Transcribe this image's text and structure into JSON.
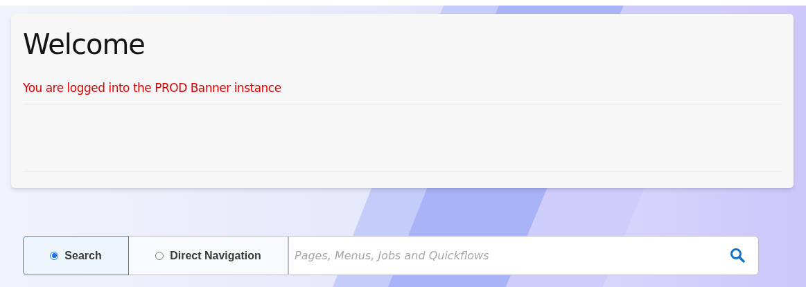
{
  "welcome": {
    "title": "Welcome",
    "message": "You are logged into the PROD Banner instance"
  },
  "search_modes": [
    {
      "label": "Search",
      "selected": true
    },
    {
      "label": "Direct Navigation",
      "selected": false
    }
  ],
  "search": {
    "placeholder": "Pages, Menus, Jobs and Quickflows"
  }
}
